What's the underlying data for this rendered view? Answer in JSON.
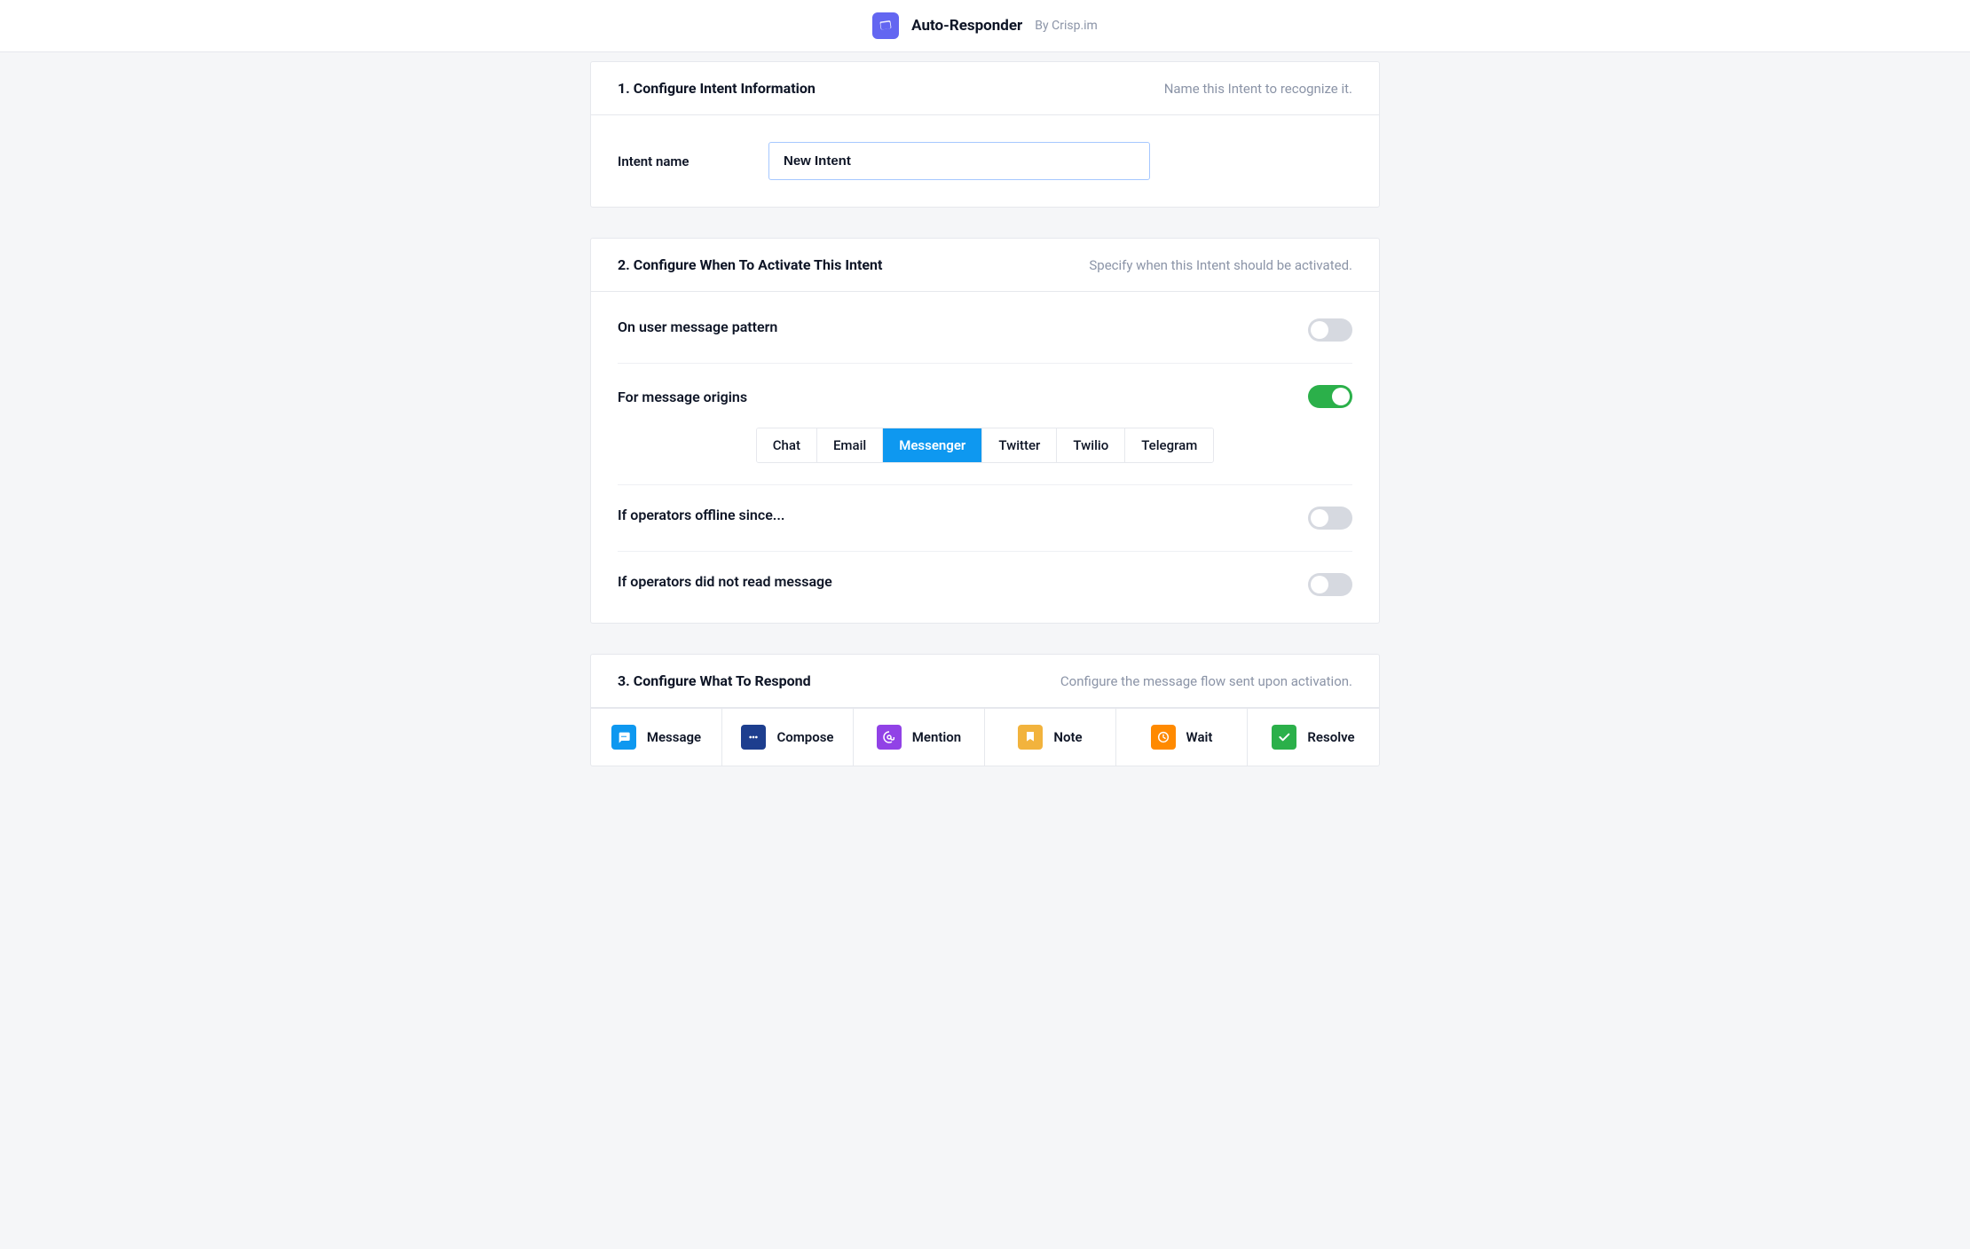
{
  "header": {
    "title": "Auto-Responder",
    "byline": "By Crisp.im"
  },
  "section1": {
    "title": "1. Configure Intent Information",
    "subtitle": "Name this Intent to recognize it.",
    "intent_name_label": "Intent name",
    "intent_name_value": "New Intent"
  },
  "section2": {
    "title": "2. Configure When To Activate This Intent",
    "subtitle": "Specify when this Intent should be activated.",
    "settings": {
      "pattern_label": "On user message pattern",
      "pattern_enabled": false,
      "origins_label": "For message origins",
      "origins_enabled": true,
      "origin_options": [
        {
          "label": "Chat",
          "active": false
        },
        {
          "label": "Email",
          "active": false
        },
        {
          "label": "Messenger",
          "active": true
        },
        {
          "label": "Twitter",
          "active": false
        },
        {
          "label": "Twilio",
          "active": false
        },
        {
          "label": "Telegram",
          "active": false
        }
      ],
      "offline_label": "If operators offline since...",
      "offline_enabled": false,
      "unread_label": "If operators did not read message",
      "unread_enabled": false
    }
  },
  "section3": {
    "title": "3. Configure What To Respond",
    "subtitle": "Configure the message flow sent upon activation.",
    "actions": [
      {
        "label": "Message",
        "color": "#0e98f0",
        "icon": "message"
      },
      {
        "label": "Compose",
        "color": "#1d3e8e",
        "icon": "compose"
      },
      {
        "label": "Mention",
        "color": "#9142e6",
        "icon": "mention"
      },
      {
        "label": "Note",
        "color": "#f2b33d",
        "icon": "note"
      },
      {
        "label": "Wait",
        "color": "#ff8a00",
        "icon": "wait"
      },
      {
        "label": "Resolve",
        "color": "#2bb04a",
        "icon": "resolve"
      }
    ]
  }
}
